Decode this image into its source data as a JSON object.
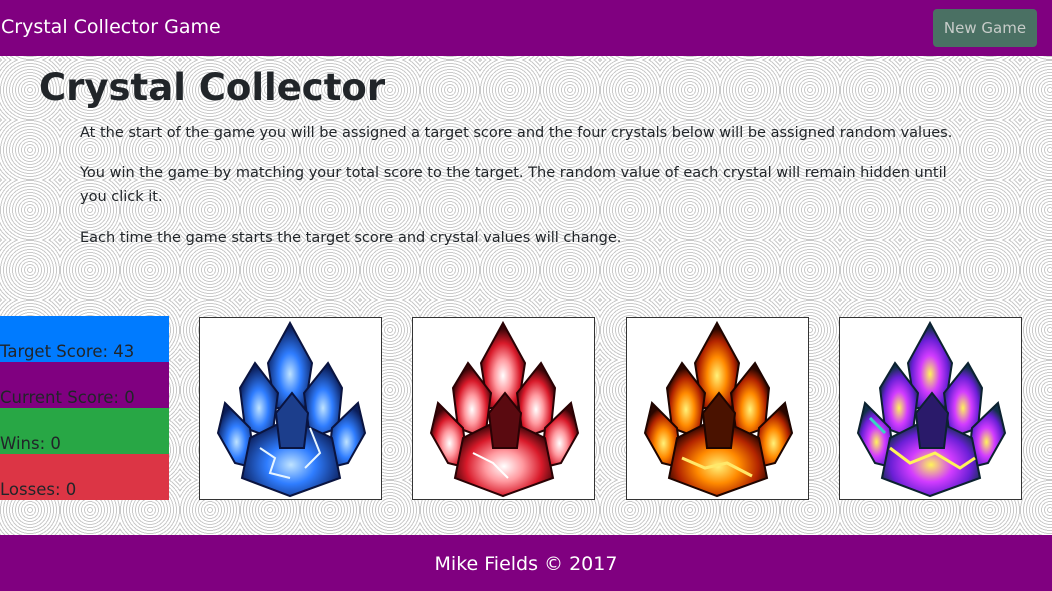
{
  "navbar": {
    "brand": "Crystal Collector Game",
    "new_game_label": "New Game"
  },
  "main": {
    "title": "Crystal Collector",
    "paragraphs": [
      "At the start of the game you will be assigned a target score and the four crystals below will be assigned random values.",
      "You win the game by matching your total score to the target. The random value of each crystal will remain hidden until you click it.",
      "Each time the game starts the target score and crystal values will change."
    ]
  },
  "stats": {
    "target": "Target Score: 43",
    "current": "Current Score: 0",
    "wins": "Wins: 0",
    "losses": "Losses: 0"
  },
  "colors": {
    "header_bg": "#800080",
    "target_bg": "#007bff",
    "current_bg": "#800080",
    "wins_bg": "#28a745",
    "losses_bg": "#dc3545"
  },
  "crystals": [
    {
      "icon": "blue-crystal-icon",
      "color": "#2f7dff"
    },
    {
      "icon": "red-crystal-icon",
      "color": "#d81a2a"
    },
    {
      "icon": "orange-crystal-icon",
      "color": "#ff8a00"
    },
    {
      "icon": "purple-crystal-icon",
      "color": "#9b2cff"
    }
  ],
  "footer": {
    "text": "Mike Fields © 2017"
  }
}
